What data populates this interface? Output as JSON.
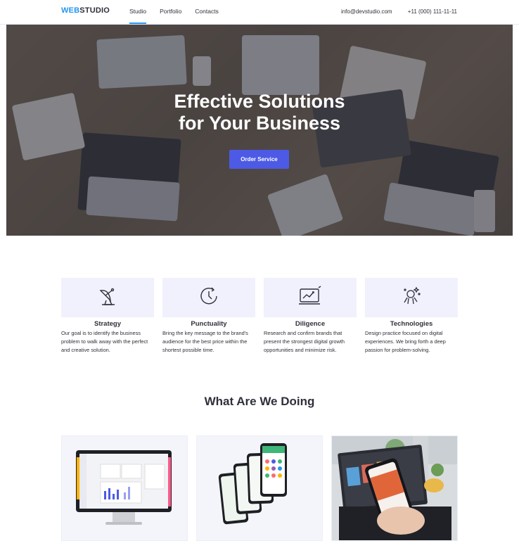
{
  "header": {
    "logo_part1": "WEB",
    "logo_part2": "STUDIO",
    "nav": [
      "Studio",
      "Portfolio",
      "Contacts"
    ],
    "email": "info@devstudio.com",
    "phone": "+11 (000) 111-11-11"
  },
  "hero": {
    "title_line1": "Effective Solutions",
    "title_line2": "for Your Business",
    "button": "Order Service"
  },
  "features": [
    {
      "title": "Strategy",
      "icon": "satellite-dish-icon",
      "desc": "Our goal is to identify the business problem to walk away with the perfect and creative solution."
    },
    {
      "title": "Punctuality",
      "icon": "clock-icon",
      "desc": "Bring the key message to the brand's audience for the best price within the shortest possible time."
    },
    {
      "title": "Diligence",
      "icon": "monitor-chart-icon",
      "desc": "Research and confirm brands that present the strongest digital growth opportunities and minimize risk."
    },
    {
      "title": "Technologies",
      "icon": "astronaut-icon",
      "desc": "Design practice focused on digital experiences. We bring forth a deep passion for problem-solving."
    }
  ],
  "section": {
    "title": "What Are We Doing"
  },
  "cards": [
    {
      "icon": "desktop-dashboard-icon"
    },
    {
      "icon": "mobile-app-screens-icon"
    },
    {
      "icon": "phone-in-hand-icon"
    }
  ]
}
